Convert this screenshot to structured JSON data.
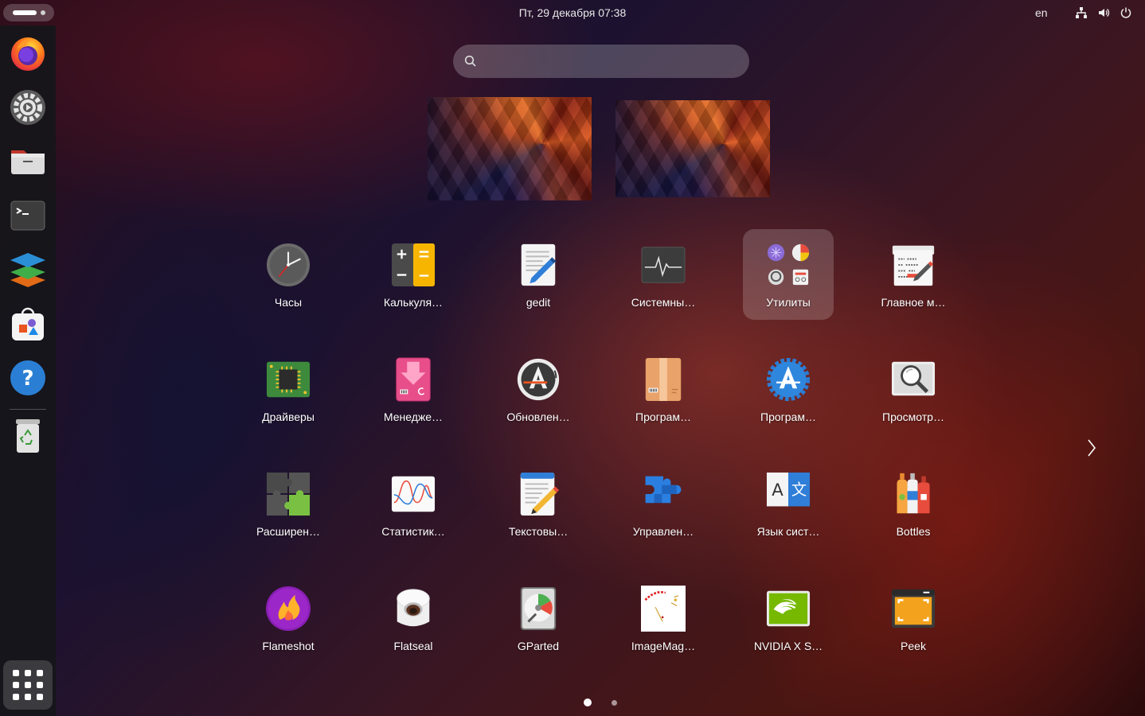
{
  "topbar": {
    "clock": "Пт, 29 декабря  07:38",
    "language": "en"
  },
  "dock": {
    "items": [
      {
        "name": "firefox"
      },
      {
        "name": "settings"
      },
      {
        "name": "files"
      },
      {
        "name": "terminal"
      },
      {
        "name": "layers-app"
      },
      {
        "name": "app-center"
      },
      {
        "name": "help"
      },
      {
        "name": "trash"
      }
    ]
  },
  "search": {
    "placeholder": "",
    "value": ""
  },
  "apps": [
    {
      "label": "Часы",
      "icon": "clock-icon"
    },
    {
      "label": "Калькуля…",
      "icon": "calculator-icon"
    },
    {
      "label": "gedit",
      "icon": "gedit-icon"
    },
    {
      "label": "Системны…",
      "icon": "system-monitor-icon"
    },
    {
      "label": "Утилиты",
      "icon": "utilities-folder-icon"
    },
    {
      "label": "Главное м…",
      "icon": "main-menu-icon"
    },
    {
      "label": "Драйверы",
      "icon": "drivers-chip-icon"
    },
    {
      "label": "Менедже…",
      "icon": "package-manager-icon"
    },
    {
      "label": "Обновлен…",
      "icon": "software-updater-icon"
    },
    {
      "label": "Програм…",
      "icon": "package-box-icon"
    },
    {
      "label": "Програм…",
      "icon": "software-properties-icon"
    },
    {
      "label": "Просмотр…",
      "icon": "image-viewer-icon"
    },
    {
      "label": "Расширен…",
      "icon": "extensions-puzzle-icon"
    },
    {
      "label": "Статистик…",
      "icon": "statistics-chart-icon"
    },
    {
      "label": "Текстовы…",
      "icon": "text-editor-icon"
    },
    {
      "label": "Управлен…",
      "icon": "extension-manager-icon"
    },
    {
      "label": "Язык сист…",
      "icon": "language-support-icon"
    },
    {
      "label": "Bottles",
      "icon": "bottles-icon"
    },
    {
      "label": "Flameshot",
      "icon": "flameshot-icon"
    },
    {
      "label": "Flatseal",
      "icon": "flatseal-icon"
    },
    {
      "label": "GParted",
      "icon": "gparted-icon"
    },
    {
      "label": "ImageMag…",
      "icon": "imagemagick-icon"
    },
    {
      "label": "NVIDIA X S…",
      "icon": "nvidia-icon"
    },
    {
      "label": "Peek",
      "icon": "peek-icon"
    }
  ],
  "pagination": {
    "pages": 2,
    "current": 1
  }
}
